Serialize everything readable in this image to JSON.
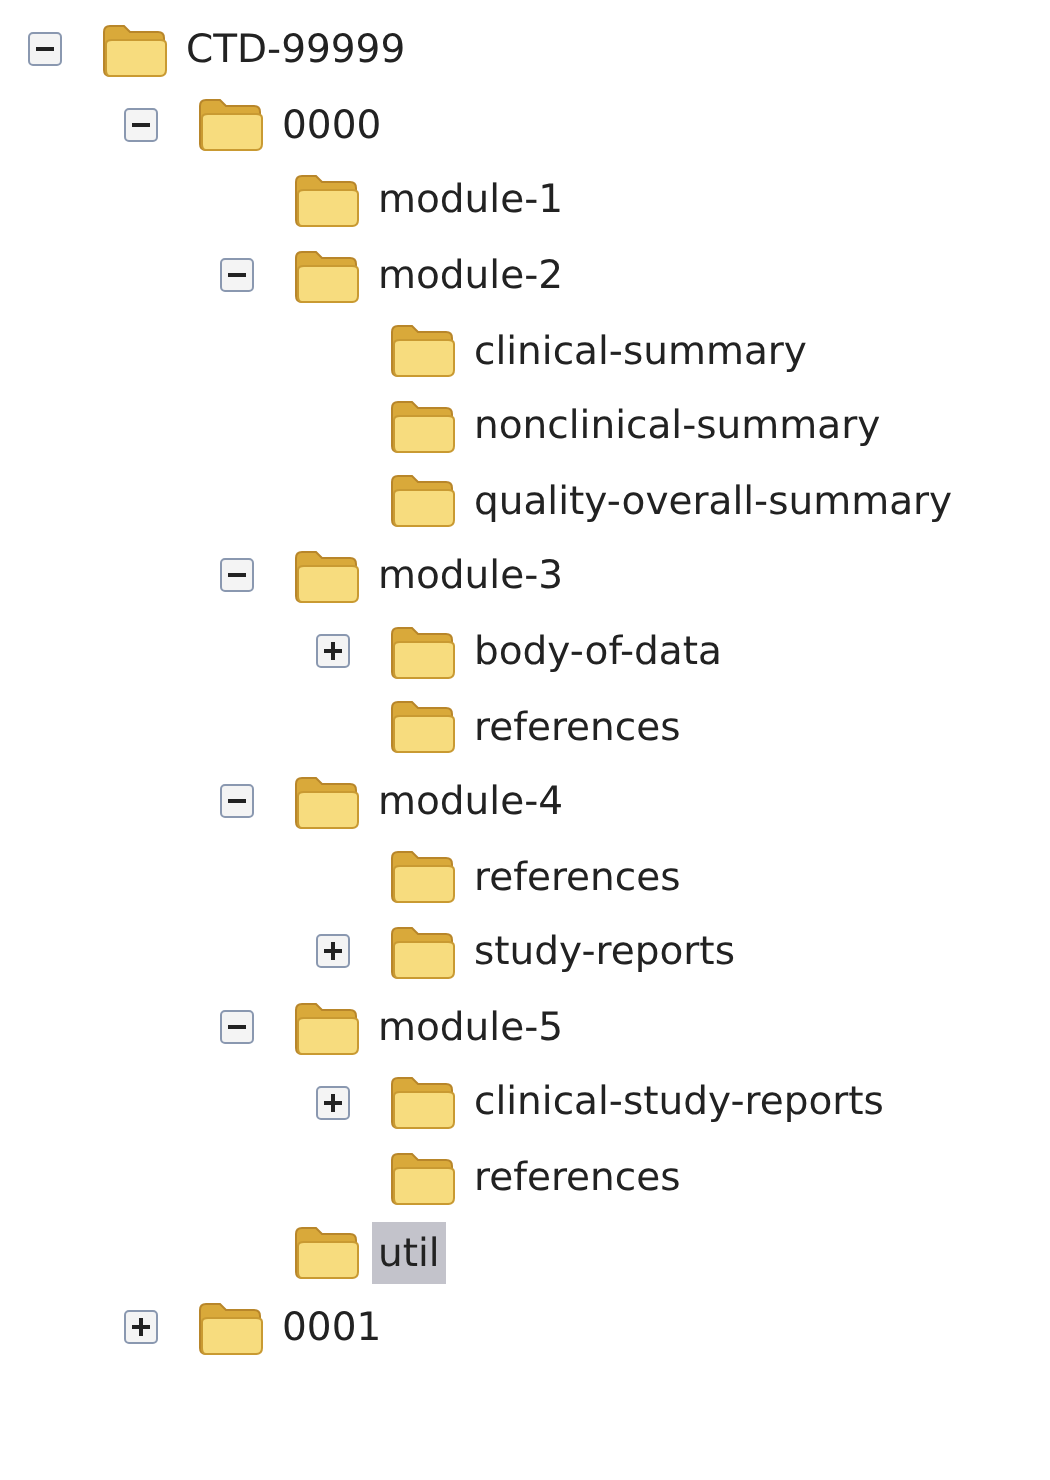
{
  "tree": [
    {
      "label": "CTD-99999",
      "expanded": true,
      "selected": false,
      "children": [
        {
          "label": "0000",
          "expanded": true,
          "selected": false,
          "children": [
            {
              "label": "module-1",
              "selected": false
            },
            {
              "label": "module-2",
              "expanded": true,
              "selected": false,
              "children": [
                {
                  "label": "clinical-summary",
                  "selected": false
                },
                {
                  "label": "nonclinical-summary",
                  "selected": false
                },
                {
                  "label": "quality-overall-summary",
                  "selected": false
                }
              ]
            },
            {
              "label": "module-3",
              "expanded": true,
              "selected": false,
              "children": [
                {
                  "label": "body-of-data",
                  "expanded": false,
                  "selected": false
                },
                {
                  "label": "references",
                  "selected": false
                }
              ]
            },
            {
              "label": "module-4",
              "expanded": true,
              "selected": false,
              "children": [
                {
                  "label": "references",
                  "selected": false
                },
                {
                  "label": "study-reports",
                  "expanded": false,
                  "selected": false
                }
              ]
            },
            {
              "label": "module-5",
              "expanded": true,
              "selected": false,
              "children": [
                {
                  "label": "clinical-study-reports",
                  "expanded": false,
                  "selected": false
                },
                {
                  "label": "references",
                  "selected": false
                }
              ]
            },
            {
              "label": "util",
              "selected": true
            }
          ]
        },
        {
          "label": "0001",
          "expanded": false,
          "selected": false
        }
      ]
    }
  ]
}
